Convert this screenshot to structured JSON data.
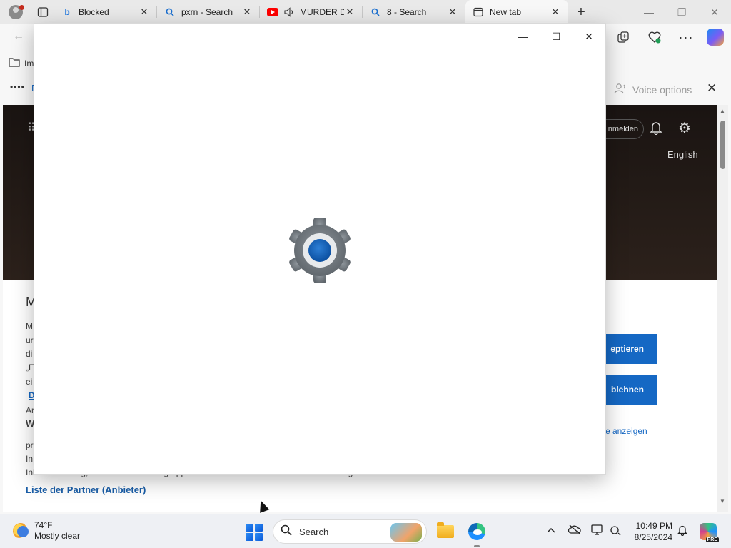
{
  "browser": {
    "tabs": [
      {
        "label": "Blocked",
        "icon": "bing-icon"
      },
      {
        "label": "pxrn - Search",
        "icon": "search-icon"
      },
      {
        "label": "MURDER D",
        "icon": "youtube-icon"
      },
      {
        "label": "8 - Search",
        "icon": "search-icon"
      },
      {
        "label": "New tab",
        "icon": "newtab-icon"
      }
    ],
    "favorites_label": "Im",
    "read_aloud": {
      "dots": "••••",
      "letter": "B",
      "voice_options": "Voice options"
    }
  },
  "page": {
    "header": {
      "signin_label": "nmelden",
      "language": "English"
    },
    "consent": {
      "heading": "M",
      "lines": [
        "M",
        "ur",
        "di",
        "„E",
        "ei",
        "D",
        "Ar",
        "W",
        "pr",
        "In"
      ],
      "bottom_line": "Inhaltsmessung, Einblicke in die Zielgruppe und Informationen zur Produktentwicklung bereitzustellen.",
      "accept_label": "eptieren",
      "reject_label": "blehnen",
      "manage_link": "e anzeigen",
      "partners_link": "Liste der Partner (Anbieter)"
    }
  },
  "settings_window": {
    "splash_icon": "settings-gear-icon"
  },
  "taskbar": {
    "weather": {
      "temp": "74°F",
      "condition": "Mostly clear"
    },
    "search_label": "Search",
    "clock": {
      "time": "10:49 PM",
      "date": "8/25/2024"
    },
    "pre_badge": "PRE"
  }
}
